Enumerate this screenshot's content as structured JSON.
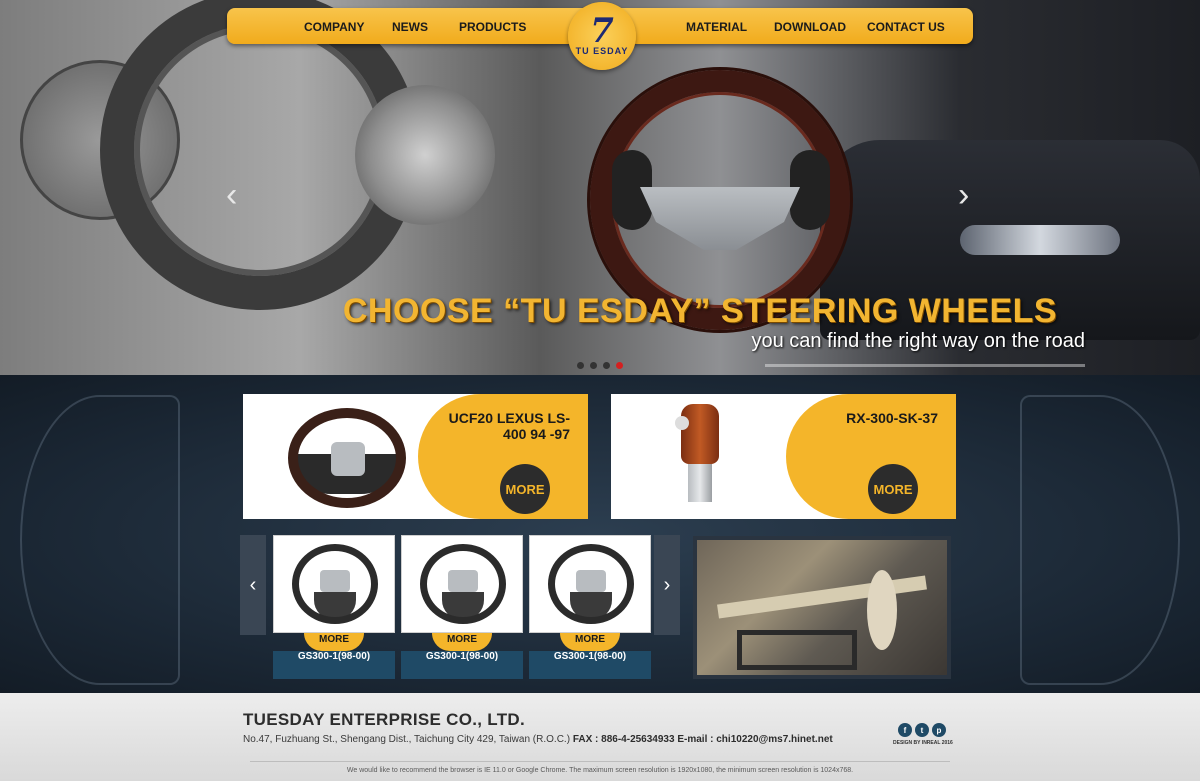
{
  "nav": {
    "items": [
      "COMPANY",
      "NEWS",
      "PRODUCTS",
      "MATERIAL",
      "DOWNLOAD",
      "CONTACT US"
    ],
    "logo_mark": "7",
    "logo_text": "TU ESDAY"
  },
  "hero": {
    "title": "CHOOSE “TU ESDAY” STEERING WHEELS",
    "subtitle": "you can find the right way on the road",
    "prev_arrow": "‹",
    "next_arrow": "›",
    "active_slide": 4
  },
  "featured": [
    {
      "name": "UCF20  LEXUS LS-400 94 -97",
      "more": "MORE"
    },
    {
      "name": "RX-300-SK-37",
      "more": "MORE"
    }
  ],
  "carousel": {
    "prev": "‹",
    "next": "›",
    "items": [
      {
        "more": "MORE",
        "name": "GS300-1(98-00)"
      },
      {
        "more": "MORE",
        "name": "GS300-1(98-00)"
      },
      {
        "more": "MORE",
        "name": "GS300-1(98-00)"
      }
    ]
  },
  "footer": {
    "company": "TUESDAY ENTERPRISE CO., LTD.",
    "address": "No.47, Fuzhuang St., Shengang Dist., Taichung City 429, Taiwan (R.O.C.)",
    "fax_label": "FAX :",
    "fax": "886-4-25634933",
    "email_label": "E-mail :",
    "email": "chi10220@ms7.hinet.net",
    "social": [
      "f",
      "t",
      "p"
    ],
    "design_credit": "DESIGN BY INREAL 2016",
    "browser_note": "We would like to recommend the browser is IE 11.0 or Google Chrome. The maximum screen resolution is 1920x1080, the minimum screen resolution is 1024x768."
  }
}
